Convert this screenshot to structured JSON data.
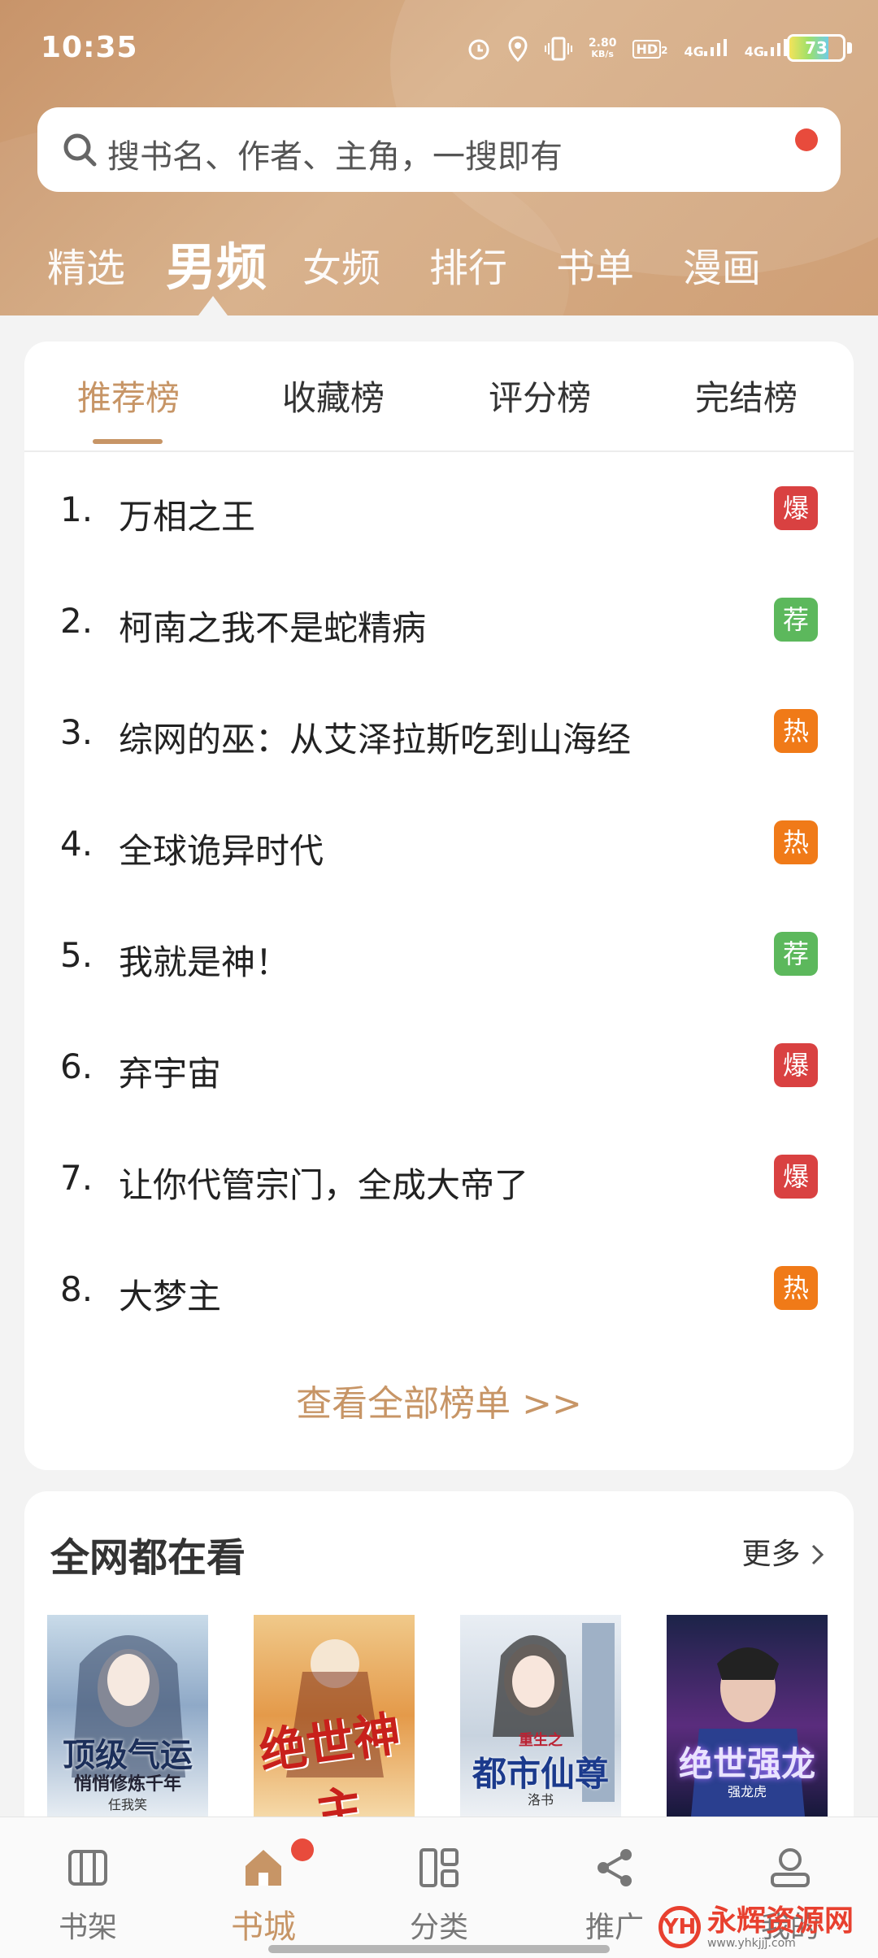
{
  "status": {
    "time": "10:35",
    "speed_top": "2.80",
    "speed_unit": "KB/s",
    "hd": "HD",
    "hd_sub": "2",
    "net1": "4G",
    "net2": "4G",
    "battery": "73",
    "battery_level": 0.73
  },
  "search": {
    "placeholder": "搜书名、作者、主角，一搜即有"
  },
  "top_tabs": [
    {
      "label": "精选"
    },
    {
      "label": "男频"
    },
    {
      "label": "女频"
    },
    {
      "label": "排行"
    },
    {
      "label": "书单"
    },
    {
      "label": "漫画"
    }
  ],
  "rank": {
    "tabs": [
      {
        "label": "推荐榜"
      },
      {
        "label": "收藏榜"
      },
      {
        "label": "评分榜"
      },
      {
        "label": "完结榜"
      }
    ],
    "items": [
      {
        "num": "1.",
        "title": "万相之王",
        "badge": "爆"
      },
      {
        "num": "2.",
        "title": "柯南之我不是蛇精病",
        "badge": "荐"
      },
      {
        "num": "3.",
        "title": "综网的巫：从艾泽拉斯吃到山海经",
        "badge": "热"
      },
      {
        "num": "4.",
        "title": "全球诡异时代",
        "badge": "热"
      },
      {
        "num": "5.",
        "title": "我就是神！",
        "badge": "荐"
      },
      {
        "num": "6.",
        "title": "弃宇宙",
        "badge": "爆"
      },
      {
        "num": "7.",
        "title": "让你代管宗门，全成大帝了",
        "badge": "爆"
      },
      {
        "num": "8.",
        "title": "大梦主",
        "badge": "热"
      }
    ],
    "more": "查看全部榜单 >>"
  },
  "badge_colors": {
    "爆": "#d94141",
    "荐": "#5cb85c",
    "热": "#f07a18"
  },
  "watch": {
    "title": "全网都在看",
    "more": "更多",
    "covers": [
      {
        "text": "顶级气运",
        "sub": "悄悄修炼千年",
        "author": "任我笑"
      },
      {
        "text": "绝世神主",
        "sub": "",
        "author": ""
      },
      {
        "text": "都市仙尊",
        "sub": "重生之",
        "author": "洛书"
      },
      {
        "text": "绝世强龙",
        "sub": "",
        "author": "强龙虎"
      }
    ]
  },
  "nav": [
    {
      "label": "书架",
      "icon": "bookshelf-icon"
    },
    {
      "label": "书城",
      "icon": "store-home-icon"
    },
    {
      "label": "分类",
      "icon": "category-grid-icon"
    },
    {
      "label": "推广",
      "icon": "share-icon"
    },
    {
      "label": "我的",
      "icon": "user-icon"
    }
  ],
  "watermark": {
    "name": "永辉资源网",
    "url": "www.yhkjjj.com"
  },
  "colors": {
    "accent": "#c79566",
    "header": "#cf9f76",
    "dot": "#e84b3c"
  }
}
